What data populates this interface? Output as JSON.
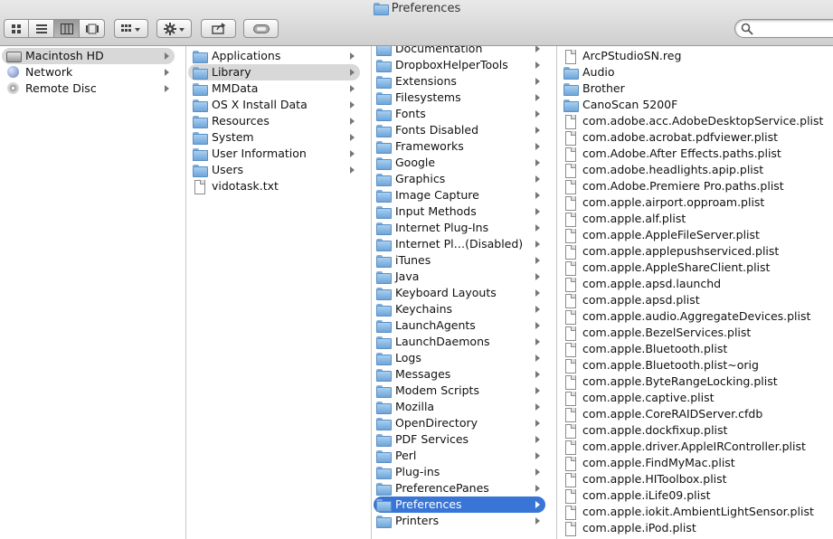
{
  "window": {
    "title": "Preferences"
  },
  "toolbar": {
    "view_modes": [
      "icon-view-icon",
      "list-view-icon",
      "column-view-icon",
      "coverflow-view-icon"
    ],
    "active_view": "column"
  },
  "sidebar": {
    "items": [
      {
        "label": "Macintosh HD",
        "icon": "drive-icon"
      },
      {
        "label": "Network",
        "icon": "globe-icon"
      },
      {
        "label": "Remote Disc",
        "icon": "disc-icon"
      }
    ]
  },
  "root": {
    "items": [
      {
        "label": "Applications",
        "type": "folder"
      },
      {
        "label": "Library",
        "type": "folder"
      },
      {
        "label": "MMData",
        "type": "folder"
      },
      {
        "label": "OS X Install Data",
        "type": "folder"
      },
      {
        "label": "Resources",
        "type": "folder"
      },
      {
        "label": "System",
        "type": "folder"
      },
      {
        "label": "User Information",
        "type": "alias"
      },
      {
        "label": "Users",
        "type": "folder"
      },
      {
        "label": "vidotask.txt",
        "type": "file"
      }
    ]
  },
  "library": {
    "items": [
      "Documentation",
      "DropboxHelperTools",
      "Extensions",
      "Filesystems",
      "Fonts",
      "Fonts Disabled",
      "Frameworks",
      "Google",
      "Graphics",
      "Image Capture",
      "Input Methods",
      "Internet Plug-Ins",
      "Internet Pl…(Disabled)",
      "iTunes",
      "Java",
      "Keyboard Layouts",
      "Keychains",
      "LaunchAgents",
      "LaunchDaemons",
      "Logs",
      "Messages",
      "Modem Scripts",
      "Mozilla",
      "OpenDirectory",
      "PDF Services",
      "Perl",
      "Plug-ins",
      "PreferencePanes",
      "Preferences",
      "Printers"
    ]
  },
  "prefs": {
    "items": [
      {
        "label": "ArcPStudioSN.reg",
        "type": "file"
      },
      {
        "label": "Audio",
        "type": "folder"
      },
      {
        "label": "Brother",
        "type": "folder"
      },
      {
        "label": "CanoScan 5200F",
        "type": "folder"
      },
      {
        "label": "com.adobe.acc.AdobeDesktopService.plist",
        "type": "file"
      },
      {
        "label": "com.adobe.acrobat.pdfviewer.plist",
        "type": "file"
      },
      {
        "label": "com.Adobe.After Effects.paths.plist",
        "type": "file"
      },
      {
        "label": "com.adobe.headlights.apip.plist",
        "type": "file"
      },
      {
        "label": "com.Adobe.Premiere Pro.paths.plist",
        "type": "file"
      },
      {
        "label": "com.apple.airport.opproam.plist",
        "type": "file"
      },
      {
        "label": "com.apple.alf.plist",
        "type": "file"
      },
      {
        "label": "com.apple.AppleFileServer.plist",
        "type": "file"
      },
      {
        "label": "com.apple.applepushserviced.plist",
        "type": "file"
      },
      {
        "label": "com.apple.AppleShareClient.plist",
        "type": "file"
      },
      {
        "label": "com.apple.apsd.launchd",
        "type": "file"
      },
      {
        "label": "com.apple.apsd.plist",
        "type": "file"
      },
      {
        "label": "com.apple.audio.AggregateDevices.plist",
        "type": "file"
      },
      {
        "label": "com.apple.BezelServices.plist",
        "type": "file"
      },
      {
        "label": "com.apple.Bluetooth.plist",
        "type": "file"
      },
      {
        "label": "com.apple.Bluetooth.plist~orig",
        "type": "file"
      },
      {
        "label": "com.apple.ByteRangeLocking.plist",
        "type": "file"
      },
      {
        "label": "com.apple.captive.plist",
        "type": "file"
      },
      {
        "label": "com.apple.CoreRAIDServer.cfdb",
        "type": "file"
      },
      {
        "label": "com.apple.dockfixup.plist",
        "type": "file"
      },
      {
        "label": "com.apple.driver.AppleIRController.plist",
        "type": "file"
      },
      {
        "label": "com.apple.FindMyMac.plist",
        "type": "file"
      },
      {
        "label": "com.apple.HIToolbox.plist",
        "type": "file"
      },
      {
        "label": "com.apple.iLife09.plist",
        "type": "file"
      },
      {
        "label": "com.apple.iokit.AmbientLightSensor.plist",
        "type": "file"
      },
      {
        "label": "com.apple.iPod.plist",
        "type": "file"
      }
    ]
  },
  "selection": {
    "sidebar": "Macintosh HD",
    "root": "Library",
    "library": "Preferences"
  },
  "colors": {
    "selection_active": "#3875d7",
    "selection_inactive": "#d8d8d8"
  }
}
